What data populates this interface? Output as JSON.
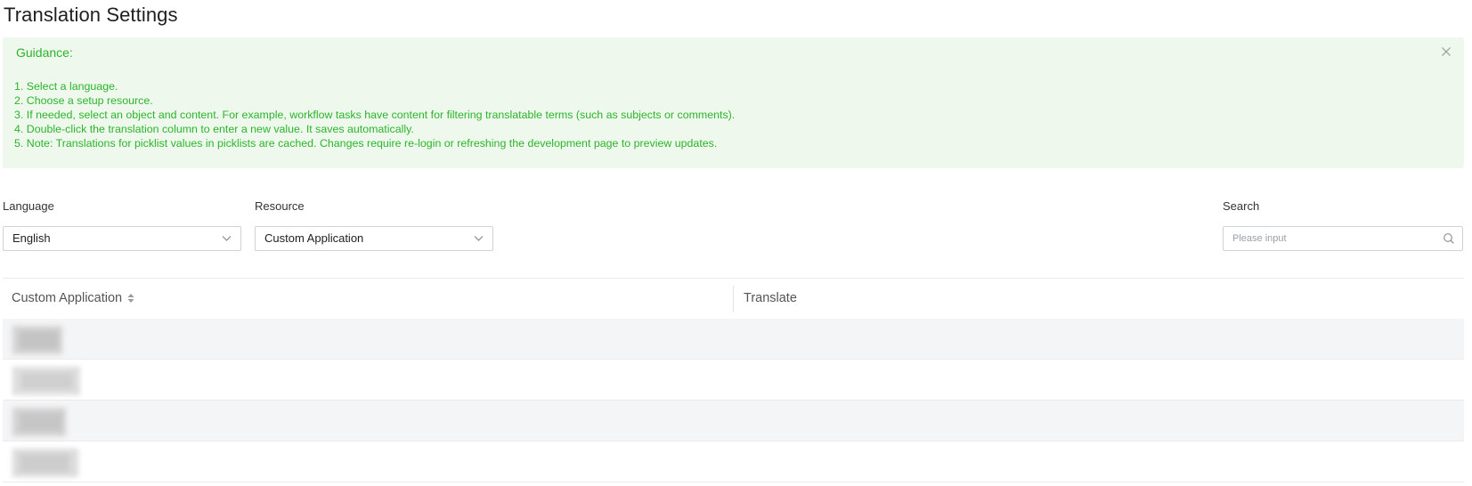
{
  "page": {
    "title": "Translation Settings"
  },
  "guidance": {
    "title": "Guidance:",
    "close_icon": "close-icon",
    "color": "#2bb52b",
    "background": "#eef8ec",
    "steps": [
      "1. Select a language.",
      "2. Choose a setup resource.",
      "3. If needed, select an object and content. For example, workflow tasks have content for filtering translatable terms (such as subjects or comments).",
      "4. Double-click the translation column to enter a new value. It saves automatically.",
      "5. Note: Translations for picklist values in picklists are cached. Changes require re-login or refreshing the development page to preview updates."
    ]
  },
  "filters": {
    "language": {
      "label": "Language",
      "value": "English",
      "icon": "chevron-down-icon"
    },
    "resource": {
      "label": "Resource",
      "value": "Custom Application",
      "icon": "chevron-down-icon"
    },
    "search": {
      "label": "Search",
      "placeholder": "Please input",
      "value": "",
      "icon": "search-icon"
    }
  },
  "table": {
    "columns": [
      {
        "label": "Custom Application",
        "sortable": true,
        "icon": "sort-icon"
      },
      {
        "label": "Translate",
        "sortable": false
      }
    ],
    "rows": [
      {
        "application": "",
        "translation": "",
        "blurred": true
      },
      {
        "application": "",
        "translation": "",
        "blurred": true
      },
      {
        "application": "",
        "translation": "",
        "blurred": true
      },
      {
        "application": "",
        "translation": "",
        "blurred": true
      }
    ],
    "row_alt_color": "#f4f5f6"
  }
}
